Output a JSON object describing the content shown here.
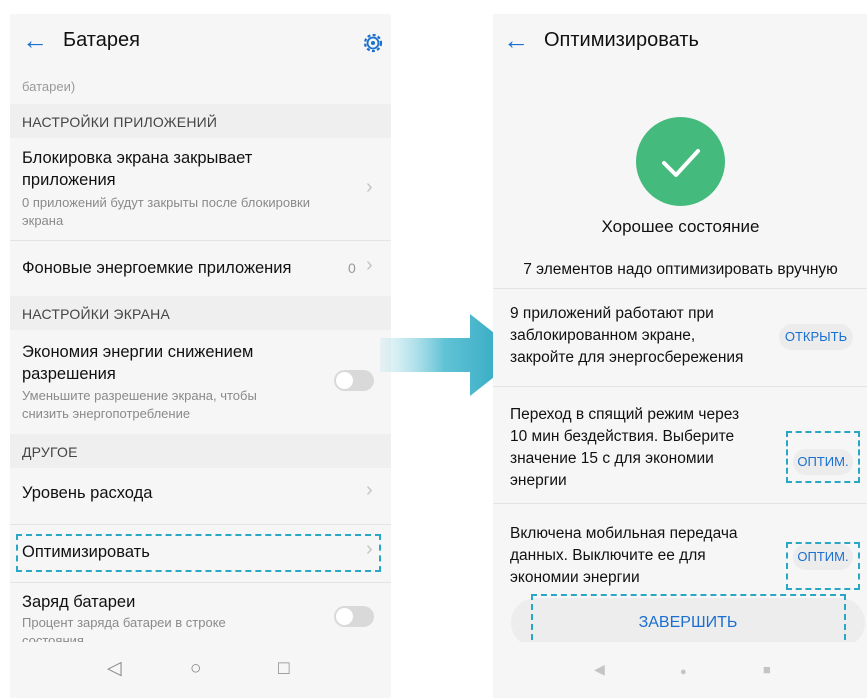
{
  "left": {
    "header": {
      "back_icon": "arrow-left",
      "title": "Батарея",
      "settings_icon": "gear"
    },
    "cut_text": "батареи)",
    "section1": "НАСТРОЙКИ ПРИЛОЖЕНИЙ",
    "lock_item": {
      "title_1": "Блокировка экрана закрывает",
      "title_2": "приложения",
      "sub_1": "0 приложений будут закрыты после блокировки",
      "sub_2": "экрана"
    },
    "bg_item": {
      "title": "Фоновые энергоемкие приложения",
      "value": "0"
    },
    "section2": "НАСТРОЙКИ ЭКРАНА",
    "res_item": {
      "title_1": "Экономия энергии снижением",
      "title_2": "разрешения",
      "sub_1": "Уменьшите разрешение экрана, чтобы",
      "sub_2": "снизить энергопотребление",
      "toggle_on": false
    },
    "section3": "ДРУГОЕ",
    "level_item": {
      "title": "Уровень расхода"
    },
    "optimize_item": {
      "title": "Оптимизировать"
    },
    "charge_item": {
      "title": "Заряд батареи",
      "sub_1": "Процент заряда батареи в строке",
      "sub_2": "состояния",
      "toggle_on": false
    },
    "nav": {
      "back": "◁",
      "home": "○",
      "recent": "□"
    }
  },
  "right": {
    "header": {
      "back_icon": "arrow-left",
      "title": "Оптимизировать"
    },
    "status": "Хорошее состояние",
    "manual_count": "7 элементов надо оптимизировать вручную",
    "item1": {
      "line_1": "9 приложений работают при",
      "line_2": "заблокированном экране,",
      "line_3": "закройте для энергосбережения",
      "button": "ОТКРЫТЬ"
    },
    "item2": {
      "line_1": "Переход в спящий режим через",
      "line_2": "10 мин бездействия. Выберите",
      "line_3": "значение 15 с для экономии",
      "line_4": "энергии",
      "button": "ОПТИМ."
    },
    "item3": {
      "line_1": "Включена мобильная передача",
      "line_2": "данных. Выключите ее для",
      "line_3": "экономии энергии",
      "button": "ОПТИМ."
    },
    "finish_button": "ЗАВЕРШИТЬ",
    "nav": {
      "back": "◀",
      "home": "●",
      "recent": "■"
    }
  },
  "colors": {
    "accent": "#1a6fd0",
    "success": "#45ba7d",
    "highlight": "#2aa7c4"
  }
}
